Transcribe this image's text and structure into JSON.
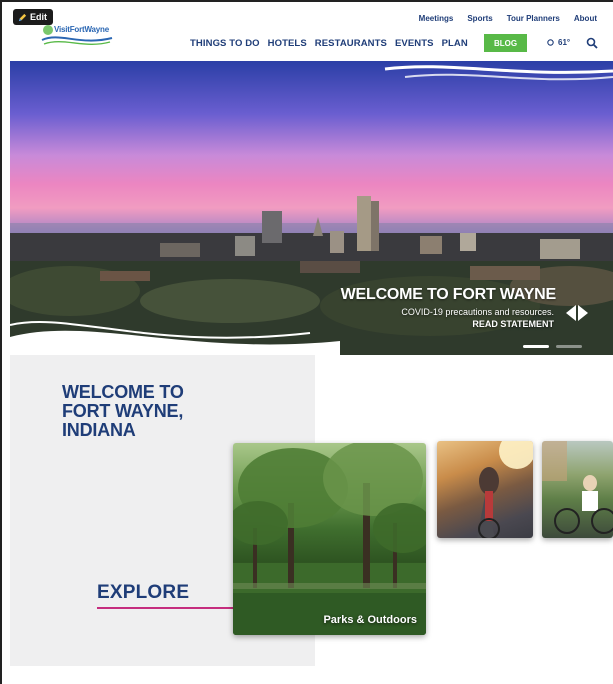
{
  "editor": {
    "edit_label": "Edit"
  },
  "header": {
    "logo_text": "VisitFortWayne",
    "utility_nav": [
      "Meetings",
      "Sports",
      "Tour Planners",
      "About"
    ],
    "main_nav": [
      "THINGS TO DO",
      "HOTELS",
      "RESTAURANTS",
      "EVENTS",
      "PLAN"
    ],
    "blog_label": "BLOG",
    "weather": "61°",
    "colors": {
      "navy": "#1f3d78",
      "blog_green": "#58b947"
    }
  },
  "hero": {
    "title": "WELCOME TO FORT WAYNE",
    "subtitle": "COVID-19 precautions and resources.",
    "link_label": "READ STATEMENT",
    "slides": 2,
    "active_slide": 1
  },
  "intro": {
    "welcome_heading": "WELCOME TO FORT WAYNE, INDIANA",
    "explore_label": "EXPLORE",
    "accent_color": "#c52d7e"
  },
  "cards": [
    {
      "label": "Parks & Outdoors"
    },
    {
      "label": ""
    },
    {
      "label": ""
    }
  ]
}
